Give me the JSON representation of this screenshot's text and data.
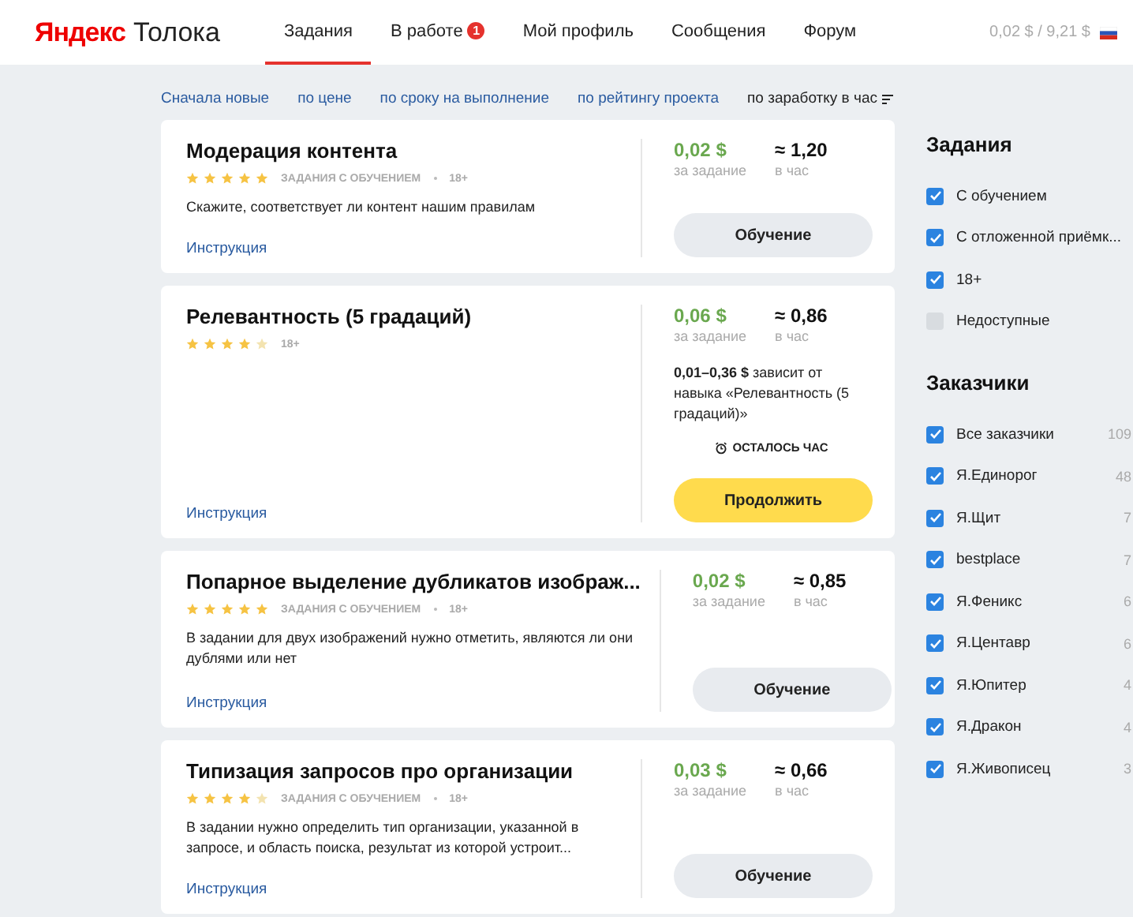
{
  "header": {
    "logo_brand": "Яндекс",
    "logo_product": "Толока",
    "nav": [
      {
        "label": "Задания",
        "selected": true
      },
      {
        "label": "В работе",
        "selected": false,
        "badge": "1"
      },
      {
        "label": "Мой профиль",
        "selected": false
      },
      {
        "label": "Сообщения",
        "selected": false
      },
      {
        "label": "Форум",
        "selected": false
      }
    ],
    "balance": "0,02 $ / 9,21 $"
  },
  "sort_options": [
    {
      "label": "Сначала новые",
      "selected": false
    },
    {
      "label": "по цене",
      "selected": false
    },
    {
      "label": "по сроку на выполнение",
      "selected": false
    },
    {
      "label": "по рейтингу проекта",
      "selected": false
    },
    {
      "label": "по заработку в час",
      "selected": true
    }
  ],
  "tasks": [
    {
      "title": "Модерация контента",
      "stars": 5,
      "tags": [
        "ЗАДАНИЯ С ОБУЧЕНИЕМ",
        "18+"
      ],
      "description": "Скажите, соответствует ли контент нашим правилам",
      "instruction": "Инструкция",
      "price": "0,02",
      "currency": "$",
      "price_label": "за задание",
      "hourly": "≈ 1,20",
      "hourly_label": "в час",
      "button": {
        "label": "Обучение",
        "kind": "training"
      }
    },
    {
      "title": "Релевантность (5 градаций)",
      "stars": 4,
      "tags": [
        "18+"
      ],
      "instruction": "Инструкция",
      "price": "0,06",
      "currency": "$",
      "price_label": "за задание",
      "hourly": "≈ 0,86",
      "hourly_label": "в час",
      "note": "**0,01–0,36 $** зависит от навыка «Релевантность (5 градаций)»",
      "timer": "ОСТАЛОСЬ ЧАС",
      "button": {
        "label": "Продолжить",
        "kind": "continue"
      }
    },
    {
      "title": "Попарное выделение дубликатов изображ...",
      "stars": 5,
      "tags": [
        "ЗАДАНИЯ С ОБУЧЕНИЕМ",
        "18+"
      ],
      "description": "В задании для двух изображений нужно отметить, являются ли они дублями или нет",
      "instruction": "Инструкция",
      "price": "0,02",
      "currency": "$",
      "price_label": "за задание",
      "hourly": "≈ 0,85",
      "hourly_label": "в час",
      "button": {
        "label": "Обучение",
        "kind": "training"
      }
    },
    {
      "title": "Типизация запросов про организации",
      "stars": 4,
      "tags": [
        "ЗАДАНИЯ С ОБУЧЕНИЕМ",
        "18+"
      ],
      "description": "В задании нужно определить тип организации, указанной в запросе, и область поиска, результат из которой устроит...",
      "instruction": "Инструкция",
      "price": "0,03",
      "currency": "$",
      "price_label": "за задание",
      "hourly": "≈ 0,66",
      "hourly_label": "в час",
      "button": {
        "label": "Обучение",
        "kind": "training"
      }
    }
  ],
  "filters": {
    "title": "Задания",
    "items": [
      {
        "label": "С обучением",
        "checked": true
      },
      {
        "label": "С отложенной приёмк...",
        "checked": true
      },
      {
        "label": "18+",
        "checked": true
      },
      {
        "label": "Недоступные",
        "checked": false
      }
    ]
  },
  "customers": {
    "title": "Заказчики",
    "items": [
      {
        "label": "Все заказчики",
        "count": "109",
        "checked": true
      },
      {
        "label": "Я.Единорог",
        "count": "48",
        "checked": true
      },
      {
        "label": "Я.Щит",
        "count": "7",
        "checked": true
      },
      {
        "label": "bestplace",
        "count": "7",
        "checked": true
      },
      {
        "label": "Я.Феникс",
        "count": "6",
        "checked": true
      },
      {
        "label": "Я.Центавр",
        "count": "6",
        "checked": true
      },
      {
        "label": "Я.Юпитер",
        "count": "4",
        "checked": true
      },
      {
        "label": "Я.Дракон",
        "count": "4",
        "checked": true
      },
      {
        "label": "Я.Живописец",
        "count": "3",
        "checked": true
      }
    ]
  }
}
